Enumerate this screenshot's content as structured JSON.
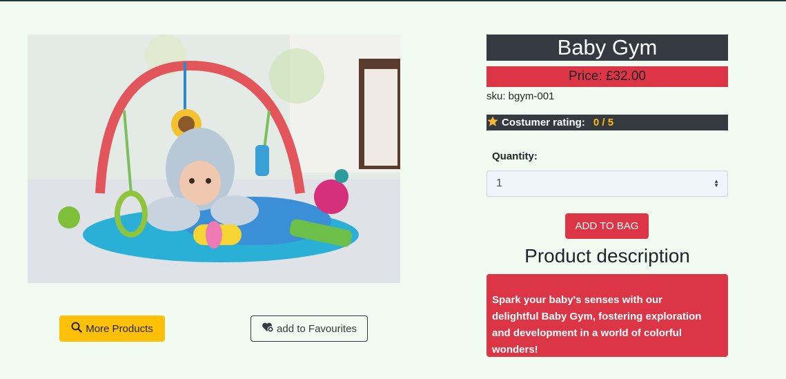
{
  "product": {
    "name": "Baby Gym",
    "price_label": "Price: £32.00",
    "sku_label": "sku: bgym-001",
    "rating_label": "Costumer rating:",
    "rating_value": "0 / 5",
    "image_alt": "Baby lying on a colorful baby gym play mat"
  },
  "form": {
    "quantity_label": "Quantity:",
    "quantity_value": "1",
    "add_to_bag_label": "ADD TO BAG"
  },
  "description": {
    "heading": "Product description",
    "text": "Spark your baby's senses with our delightful Baby Gym, fostering exploration and development in a world of colorful wonders!"
  },
  "actions": {
    "more_products_label": "More Products",
    "favourites_label": "add to Favourites"
  },
  "colors": {
    "background": "#f0faf0",
    "dark": "#343a40",
    "danger": "#dc3545",
    "warning": "#ffc107"
  },
  "icons": {
    "more_products": "magnifying-glass-icon",
    "favourites": "heart-plus-icon",
    "rating": "star-icon",
    "quantity": "select-arrows-icon"
  }
}
